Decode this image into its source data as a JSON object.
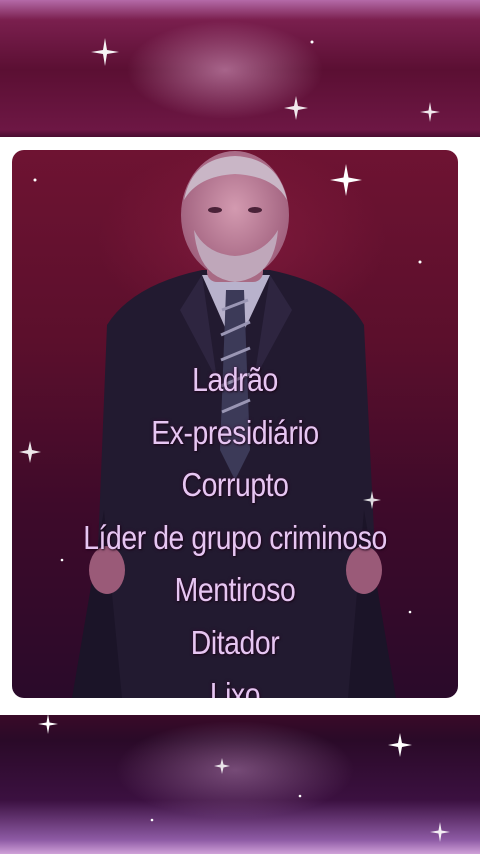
{
  "caption": {
    "lines": [
      "Ladrão",
      "Ex-presidiário",
      "Corrupto",
      "Líder de grupo criminoso",
      "Mentiroso",
      "Ditador",
      "Lixo"
    ]
  },
  "colors": {
    "text": "#e6c6f2",
    "frame": "#ffffff",
    "background": "#5b0f33",
    "sparkle": "#ffffff"
  }
}
